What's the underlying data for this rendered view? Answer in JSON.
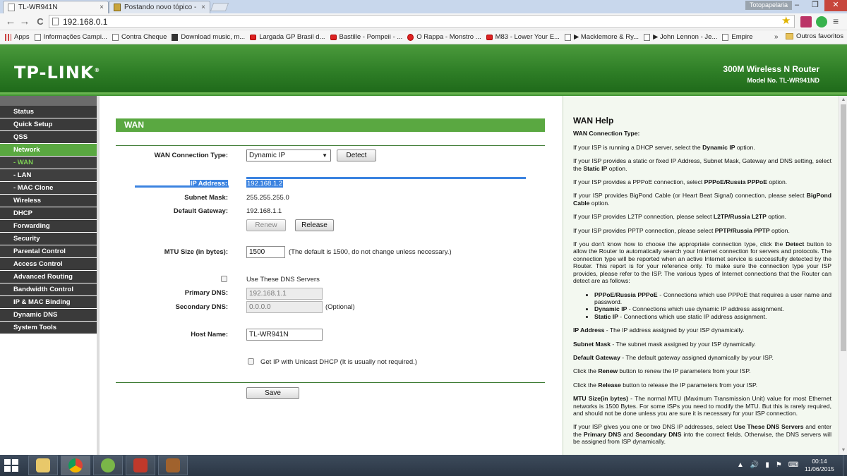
{
  "browser": {
    "tabs": [
      {
        "label": "TL-WR941N",
        "close": "×",
        "active": true
      },
      {
        "label": "Postando novo tópico - T",
        "close": "×",
        "active": false
      }
    ],
    "profile_name": "Totopapelaria",
    "window_controls": {
      "minimize": "–",
      "maximize": "❐",
      "close": "✕"
    },
    "url": "192.168.0.1",
    "nav": {
      "back": "←",
      "forward": "→",
      "reload": "C"
    },
    "star": "★",
    "menu": "≡",
    "bookmarks": [
      {
        "label": "Apps",
        "icon": "apps-icon"
      },
      {
        "label": "Informações Campi...",
        "icon": "page-icon"
      },
      {
        "label": "Contra Cheque",
        "icon": "page-icon"
      },
      {
        "label": "Download music, m...",
        "icon": "download-icon"
      },
      {
        "label": "Largada GP Brasil d...",
        "icon": "youtube-icon"
      },
      {
        "label": "Bastille - Pompeii - ...",
        "icon": "youtube-icon"
      },
      {
        "label": "O Rappa - Monstro ...",
        "icon": "opera-icon"
      },
      {
        "label": "M83 - Lower Your E...",
        "icon": "youtube-icon"
      },
      {
        "label": "▶ Macklemore & Ry...",
        "icon": "page-icon"
      },
      {
        "label": "▶ John Lennon - Je...",
        "icon": "page-icon"
      },
      {
        "label": "Empire",
        "icon": "page-icon"
      }
    ],
    "bookmarks_more": "»",
    "other_bookmarks": "Outros favoritos"
  },
  "header": {
    "logo": "TP-LINK",
    "logo_mark": "®",
    "product": "300M Wireless N Router",
    "model": "Model No. TL-WR941ND"
  },
  "sidebar": {
    "items": [
      {
        "label": "Status",
        "state": "normal"
      },
      {
        "label": "Quick Setup",
        "state": "normal"
      },
      {
        "label": "QSS",
        "state": "normal"
      },
      {
        "label": "Network",
        "state": "active"
      },
      {
        "label": "- WAN",
        "state": "current"
      },
      {
        "label": "- LAN",
        "state": "sub"
      },
      {
        "label": "- MAC Clone",
        "state": "sub"
      },
      {
        "label": "Wireless",
        "state": "normal"
      },
      {
        "label": "DHCP",
        "state": "normal"
      },
      {
        "label": "Forwarding",
        "state": "normal"
      },
      {
        "label": "Security",
        "state": "normal"
      },
      {
        "label": "Parental Control",
        "state": "normal"
      },
      {
        "label": "Access Control",
        "state": "normal"
      },
      {
        "label": "Advanced Routing",
        "state": "normal"
      },
      {
        "label": "Bandwidth Control",
        "state": "normal"
      },
      {
        "label": "IP & MAC Binding",
        "state": "normal"
      },
      {
        "label": "Dynamic DNS",
        "state": "normal"
      },
      {
        "label": "System Tools",
        "state": "normal"
      }
    ]
  },
  "wan": {
    "title": "WAN",
    "connection_type_label": "WAN Connection Type:",
    "connection_type_value": "Dynamic IP",
    "detect_button": "Detect",
    "ip_label": "IP Address:",
    "ip_value": "192.168.1.2",
    "mask_label": "Subnet Mask:",
    "mask_value": "255.255.255.0",
    "gateway_label": "Default Gateway:",
    "gateway_value": "192.168.1.1",
    "renew_button": "Renew",
    "release_button": "Release",
    "mtu_label": "MTU Size (in bytes):",
    "mtu_value": "1500",
    "mtu_note": "(The default is 1500, do not change unless necessary.)",
    "use_dns_label": "Use These DNS Servers",
    "use_dns_checked": false,
    "primary_dns_label": "Primary DNS:",
    "primary_dns_value": "192.168.1.1",
    "secondary_dns_label": "Secondary DNS:",
    "secondary_dns_value": "0.0.0.0",
    "optional_note": "(Optional)",
    "host_label": "Host Name:",
    "host_value": "TL-WR941N",
    "unicast_label": "Get IP with Unicast DHCP (It is usually not required.)",
    "unicast_checked": false,
    "save_button": "Save"
  },
  "help": {
    "title": "WAN Help",
    "subtitle": "WAN Connection Type:",
    "p1_pre": "If your ISP is running a DHCP server, select the ",
    "p1_b": "Dynamic IP",
    "p1_post": " option.",
    "p2_pre": "If your ISP provides a static or fixed IP Address, Subnet Mask, Gateway and DNS setting, select the ",
    "p2_b": "Static IP",
    "p2_post": " option.",
    "p3_pre": "If your ISP provides a PPPoE connection, select ",
    "p3_b": "PPPoE/Russia PPPoE",
    "p3_post": " option.",
    "p4_pre": "If your ISP provides BigPond Cable (or Heart Beat Signal) connection, please select ",
    "p4_b": "BigPond Cable",
    "p4_post": " option.",
    "p5_pre": "If your ISP provides L2TP connection, please select ",
    "p5_b": "L2TP/Russia L2TP",
    "p5_post": " option.",
    "p6_pre": "If your ISP provides PPTP connection, please select ",
    "p6_b": "PPTP/Russia PPTP",
    "p6_post": " option.",
    "p7_pre": "If you don't know how to choose the appropriate connection type, click the ",
    "p7_b": "Detect",
    "p7_post": " button to allow the Router to automatically search your Internet connection for servers and protocols. The connection type will be reported when an active Internet service is successfully detected by the Router. This report is for your reference only. To make sure the connection type your ISP provides, please refer to the ISP. The various types of Internet connections that the Router can detect are as follows:",
    "li1_b": "PPPoE/Russia PPPoE",
    "li1_t": " - Connections which use PPPoE that requires a user name and password.",
    "li2_b": "Dynamic IP",
    "li2_t": " - Connections which use dynamic IP address assignment.",
    "li3_b": "Static IP",
    "li3_t": " - Connections which use static IP address assignment.",
    "ip_b": "IP Address",
    "ip_t": " - The IP address assigned by your ISP dynamically.",
    "mask_b": "Subnet Mask",
    "mask_t": " - The subnet mask assigned by your ISP dynamically.",
    "gw_b": "Default Gateway",
    "gw_t": " - The default gateway assigned dynamically by your ISP.",
    "renew_pre": "Click the ",
    "renew_b": "Renew",
    "renew_post": " button to renew the IP parameters from your ISP.",
    "release_pre": "Click the ",
    "release_b": "Release",
    "release_post": " button to release the IP parameters from your ISP.",
    "mtu_b": "MTU Size(in bytes)",
    "mtu_t": " - The normal MTU (Maximum Transmission Unit) value for most Ethernet networks is 1500 Bytes. For some ISPs you need to modify the MTU. But this is rarely required, and should not be done unless you are sure it is necessary for your ISP connection.",
    "dns_pre": "If your ISP gives you one or two DNS IP addresses, select ",
    "dns_b1": "Use These DNS Servers",
    "dns_mid1": " and enter the ",
    "dns_b2": "Primary DNS",
    "dns_mid2": " and ",
    "dns_b3": "Secondary DNS",
    "dns_post": " into the correct fields. Otherwise, the DNS servers will be assigned from ISP dynamically."
  },
  "taskbar": {
    "apps": [
      "explorer-icon",
      "chrome-icon",
      "utorrent-icon",
      "game-icon",
      "squirrel-icon"
    ],
    "tray_symbols": [
      "▲",
      "🔊",
      "▮",
      "⚑",
      "⌨"
    ],
    "time": "00:14",
    "date": "11/06/2015"
  },
  "colors": {
    "brand_green": "#2f7f27",
    "menu_active": "#5aa841",
    "menu_bg": "#3a3a3a",
    "selection": "#3b83e0"
  }
}
